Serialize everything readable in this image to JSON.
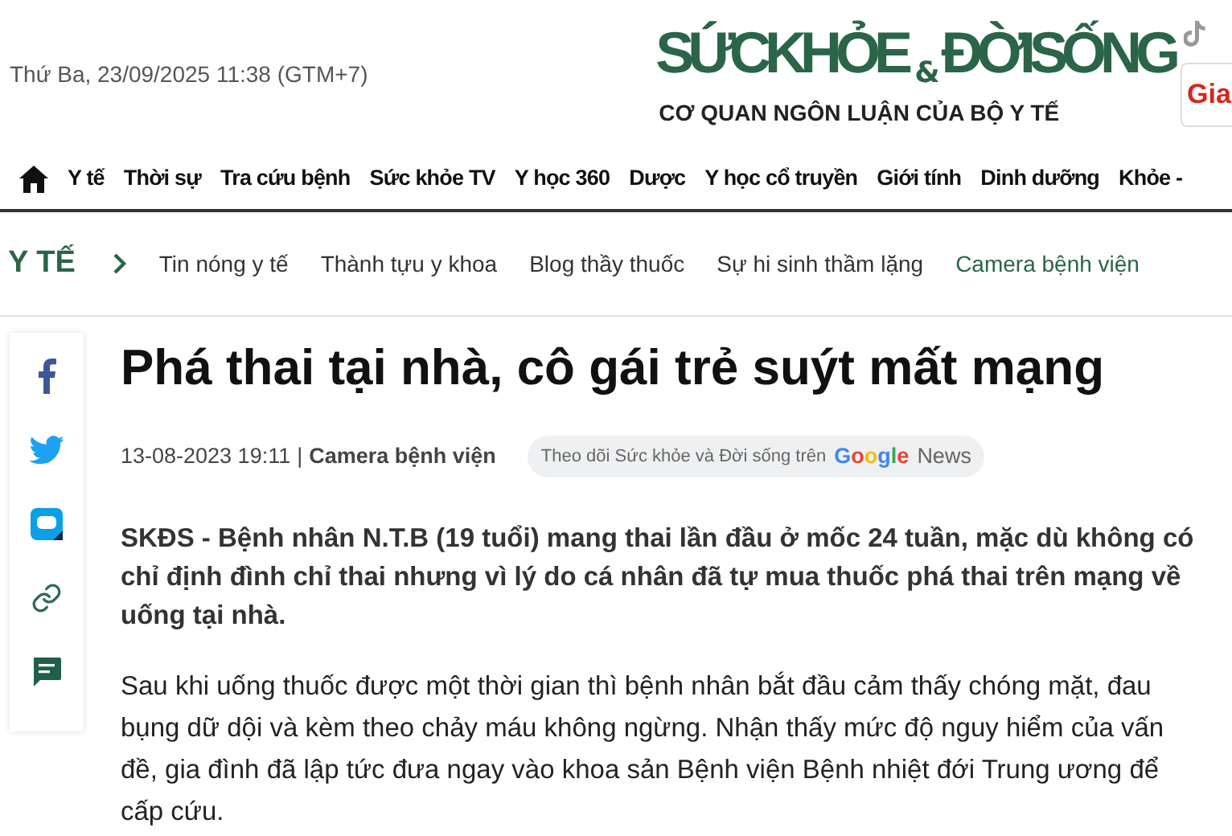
{
  "header": {
    "date": "Thứ Ba, 23/09/2025 11:38 (GTM+7)",
    "logo": {
      "left": "SỨCKHỎE",
      "amp": "&",
      "right": "ĐỜISỐNG",
      "tagline": "CƠ QUAN NGÔN LUẬN CỦA BỘ Y TẾ"
    },
    "side_badge": "Gia"
  },
  "nav": {
    "items": [
      {
        "label": "Y tế",
        "selected": false
      },
      {
        "label": "Thời sự",
        "selected": false
      },
      {
        "label": "Tra cứu bệnh",
        "selected": false
      },
      {
        "label": "Sức khỏe TV",
        "selected": false
      },
      {
        "label": "Y học 360",
        "selected": false
      },
      {
        "label": "Dược",
        "selected": false
      },
      {
        "label": "Y học cổ truyền",
        "selected": false
      },
      {
        "label": "Giới tính",
        "selected": false
      },
      {
        "label": "Dinh dưỡng",
        "selected": false
      },
      {
        "label": "Khỏe -",
        "selected": false
      }
    ]
  },
  "subnav": {
    "section": "Y TẾ",
    "items": [
      {
        "label": "Tin nóng y tế",
        "selected": false
      },
      {
        "label": "Thành tựu y khoa",
        "selected": false
      },
      {
        "label": "Blog thầy thuốc",
        "selected": false
      },
      {
        "label": "Sự hi sinh thầm lặng",
        "selected": false
      },
      {
        "label": "Camera bệnh viện",
        "selected": true
      }
    ]
  },
  "share": [
    {
      "kind": "facebook"
    },
    {
      "kind": "twitter"
    },
    {
      "kind": "zalo"
    },
    {
      "kind": "link"
    },
    {
      "kind": "comment"
    }
  ],
  "article": {
    "title": "Phá thai tại nhà, cô gái trẻ suýt mất mạng",
    "date": "13-08-2023 19:11",
    "separator": "|",
    "category": "Camera bệnh viện",
    "follow": {
      "text": "Theo dõi Sức khỏe và Đời sống trên",
      "brand": [
        "G",
        "o",
        "o",
        "g",
        "l",
        "e"
      ],
      "suffix": "News"
    },
    "lead": "SKĐS - Bệnh nhân N.T.B (19 tuổi) mang thai lần đầu ở mốc 24 tuần, mặc dù không có chỉ định đình chỉ thai nhưng vì lý do cá nhân đã tự mua thuốc phá thai trên mạng về uống tại nhà.",
    "paragraphs": [
      "Sau khi uống thuốc được một thời gian thì bệnh nhân bắt đầu cảm thấy chóng mặt, đau bụng dữ dội và kèm theo chảy máu không ngừng. Nhận thấy mức độ nguy hiểm của vấn đề, gia đình đã lập tức đưa ngay vào khoa sản Bệnh viện Bệnh nhiệt đới Trung ương để cấp cứu."
    ]
  }
}
